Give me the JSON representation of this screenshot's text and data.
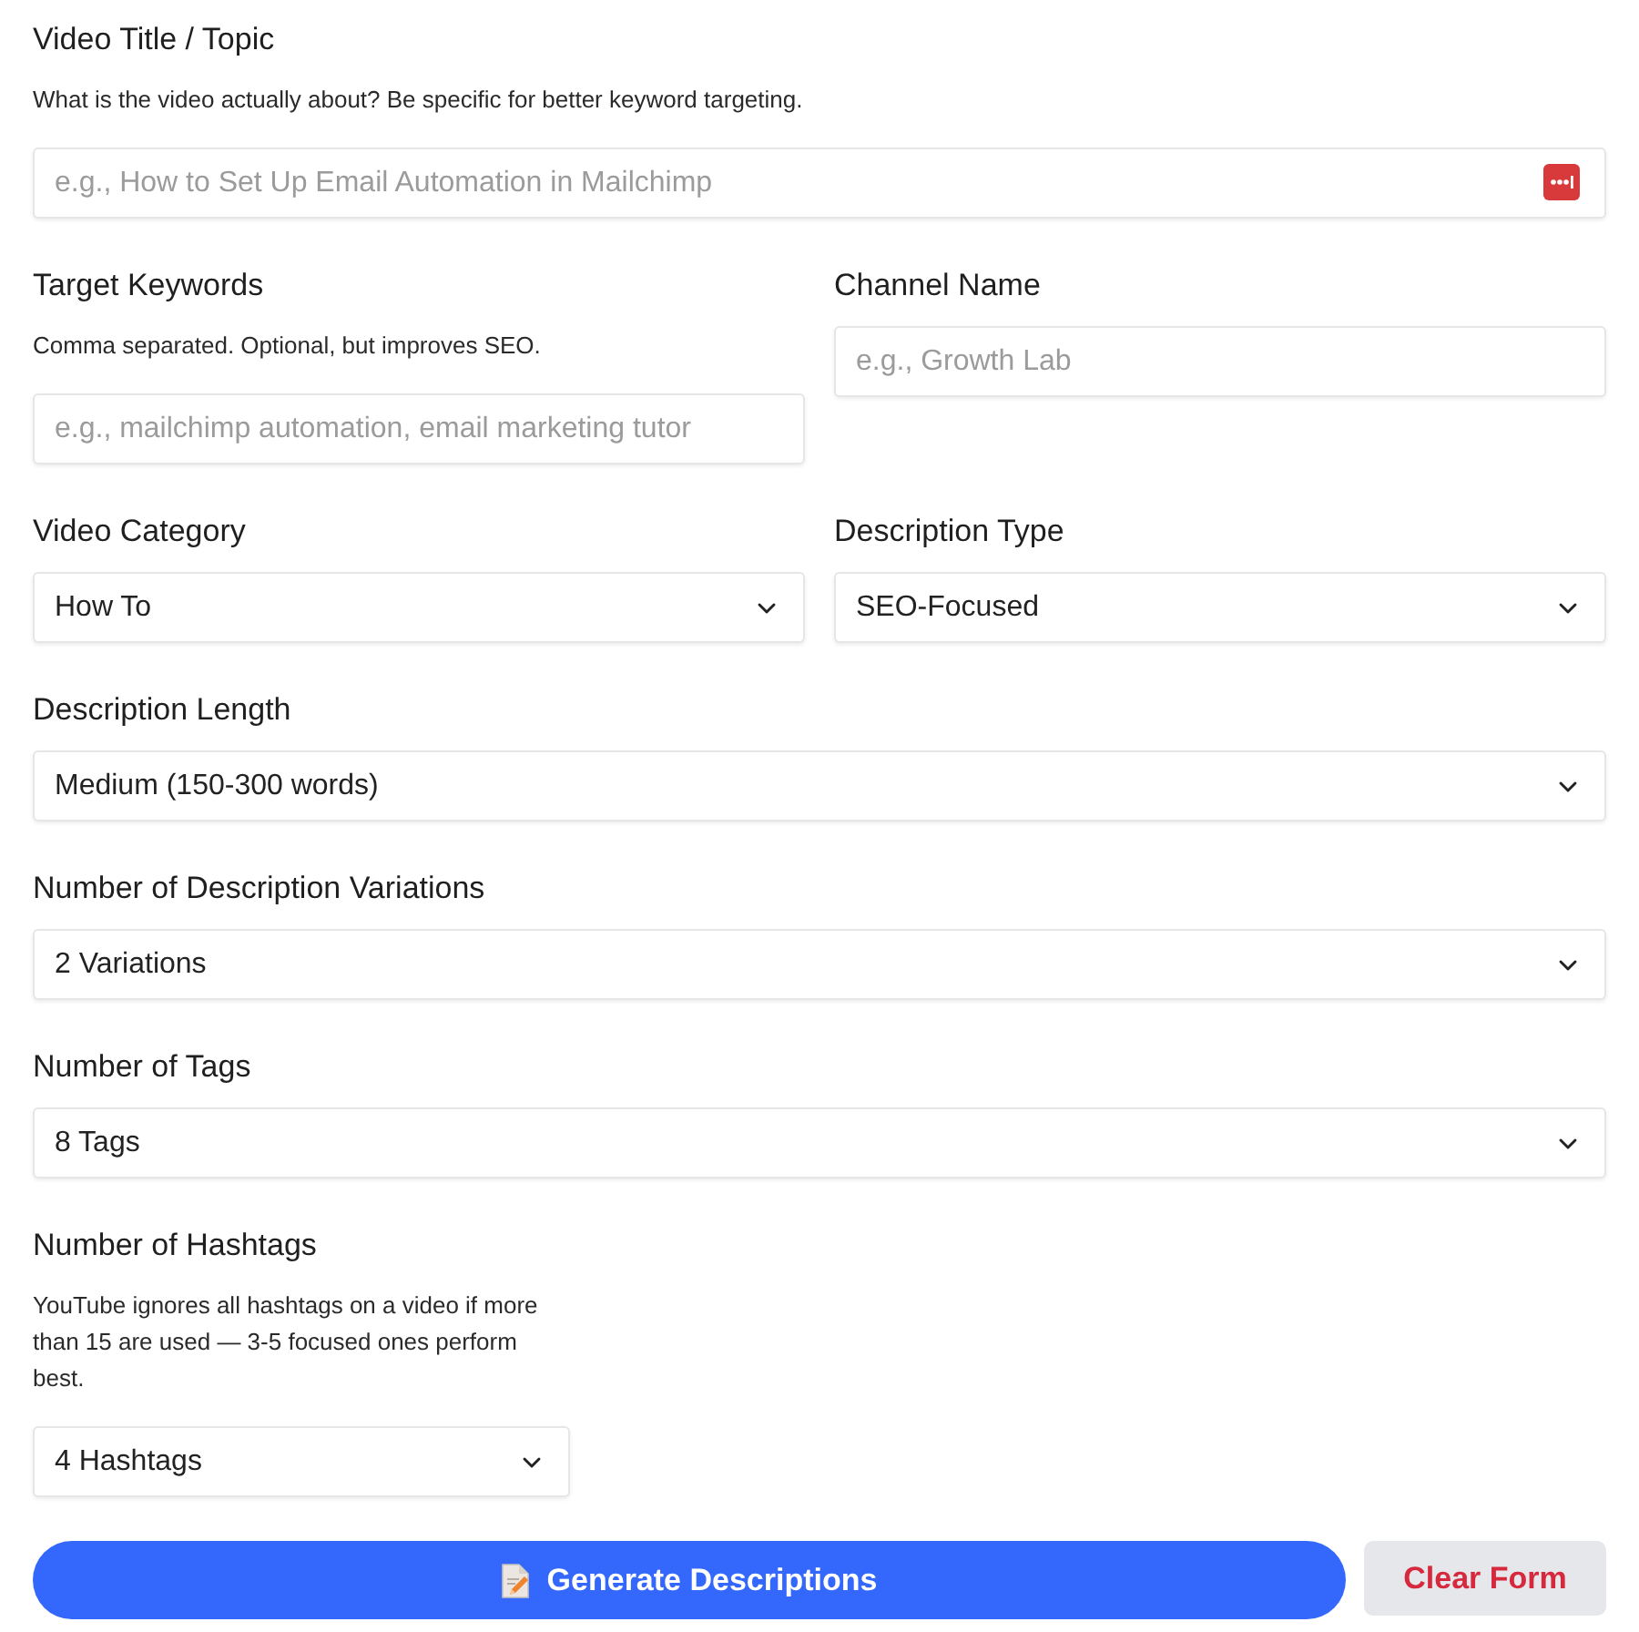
{
  "rows": [
    {
      "fields": [
        {
          "kind": "text",
          "label": "Video Title / Topic",
          "help": "What is the video actually about? Be specific for better keyword targeting.",
          "placeholder": "e.g., How to Set Up Email Automation in Mailchimp",
          "autofill_icon": true
        }
      ]
    },
    {
      "fields": [
        {
          "kind": "text",
          "label": "Target Keywords",
          "help": "Comma separated. Optional, but improves SEO.",
          "placeholder": "e.g., mailchimp automation, email marketing tutor"
        },
        {
          "kind": "text",
          "label": "Channel Name",
          "placeholder": "e.g., Growth Lab"
        }
      ]
    },
    {
      "fields": [
        {
          "kind": "select",
          "label": "Video Category",
          "value": "How To"
        },
        {
          "kind": "select",
          "label": "Description Type",
          "value": "SEO-Focused"
        }
      ]
    },
    {
      "fields": [
        {
          "kind": "select",
          "label": "Description Length",
          "value": "Medium (150-300 words)"
        }
      ]
    },
    {
      "fields": [
        {
          "kind": "select",
          "label": "Number of Description Variations",
          "value": "2 Variations"
        }
      ]
    },
    {
      "fields": [
        {
          "kind": "select",
          "label": "Number of Tags",
          "value": "8 Tags"
        }
      ]
    }
  ],
  "hashtags": {
    "kind": "select",
    "label": "Number of Hashtags",
    "help": "YouTube ignores all hashtags on a video if more than 15 are used — 3-5 focused ones perform best.",
    "value": "4 Hashtags"
  },
  "actions": [
    {
      "kind": "primary",
      "label": "Generate Descriptions"
    },
    {
      "kind": "secondary",
      "label": "Clear Form"
    }
  ]
}
